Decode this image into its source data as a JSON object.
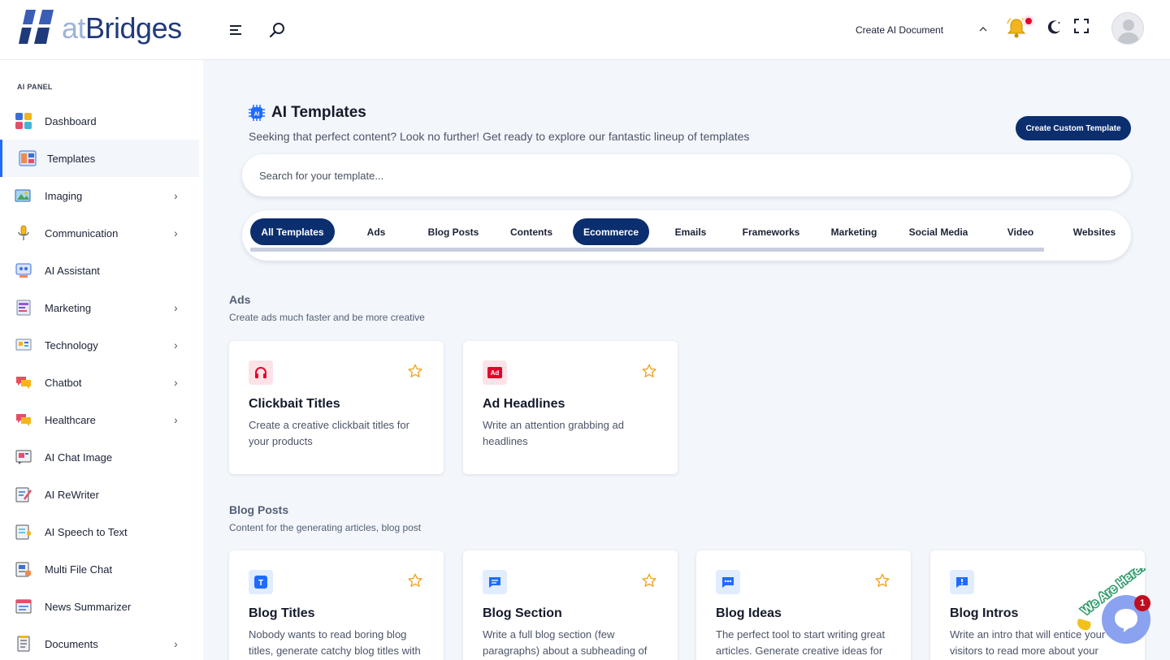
{
  "brand": {
    "logo_a": "at",
    "logo_b": "Bridges"
  },
  "header": {
    "create_doc": "Create AI Document"
  },
  "sidebar": {
    "panel_label": "AI PANEL",
    "items": [
      {
        "label": "Dashboard",
        "icon": "dashboard-icon",
        "chevron": false
      },
      {
        "label": "Templates",
        "icon": "templates-icon",
        "chevron": false,
        "active": true
      },
      {
        "label": "Imaging",
        "icon": "imaging-icon",
        "chevron": true
      },
      {
        "label": "Communication",
        "icon": "microphone-icon",
        "chevron": true
      },
      {
        "label": "AI Assistant",
        "icon": "assistant-icon",
        "chevron": false
      },
      {
        "label": "Marketing",
        "icon": "marketing-icon",
        "chevron": true
      },
      {
        "label": "Technology",
        "icon": "technology-icon",
        "chevron": true
      },
      {
        "label": "Chatbot",
        "icon": "chatbot-icon",
        "chevron": true
      },
      {
        "label": "Healthcare",
        "icon": "healthcare-icon",
        "chevron": true
      },
      {
        "label": "AI Chat Image",
        "icon": "chat-image-icon",
        "chevron": false
      },
      {
        "label": "AI ReWriter",
        "icon": "rewriter-icon",
        "chevron": false
      },
      {
        "label": "AI Speech to Text",
        "icon": "speech-icon",
        "chevron": false
      },
      {
        "label": "Multi File Chat",
        "icon": "file-chat-icon",
        "chevron": false
      },
      {
        "label": "News Summarizer",
        "icon": "news-icon",
        "chevron": false
      },
      {
        "label": "Documents",
        "icon": "documents-icon",
        "chevron": true
      }
    ]
  },
  "main": {
    "title": "AI Templates",
    "subtitle": "Seeking that perfect content? Look no further! Get ready to explore our fantastic lineup of templates",
    "custom_button": "Create Custom Template",
    "search_placeholder": "Search for your template...",
    "tabs": [
      {
        "label": "All Templates",
        "active": true
      },
      {
        "label": "Ads",
        "active": false
      },
      {
        "label": "Blog Posts",
        "active": false
      },
      {
        "label": "Contents",
        "active": false
      },
      {
        "label": "Ecommerce",
        "active": true
      },
      {
        "label": "Emails",
        "active": false
      },
      {
        "label": "Frameworks",
        "active": false
      },
      {
        "label": "Marketing",
        "active": false
      },
      {
        "label": "Social Media",
        "active": false
      },
      {
        "label": "Video",
        "active": false
      },
      {
        "label": "Websites",
        "active": false
      }
    ],
    "sections": [
      {
        "title": "Ads",
        "subtitle": "Create ads much faster and be more creative",
        "cards": [
          {
            "title": "Clickbait Titles",
            "desc": "Create a creative clickbait titles for your products",
            "icon": "headphones-icon"
          },
          {
            "title": "Ad Headlines",
            "desc": "Write an attention grabbing ad headlines",
            "icon": "ad-icon"
          }
        ]
      },
      {
        "title": "Blog Posts",
        "subtitle": "Content for the generating articles, blog post",
        "cards": [
          {
            "title": "Blog Titles",
            "desc": "Nobody wants to read boring blog titles, generate catchy blog titles with",
            "icon": "text-icon"
          },
          {
            "title": "Blog Section",
            "desc": "Write a full blog section (few paragraphs) about a subheading of",
            "icon": "message-icon"
          },
          {
            "title": "Blog Ideas",
            "desc": "The perfect tool to start writing great articles. Generate creative ideas for",
            "icon": "dots-icon"
          },
          {
            "title": "Blog Intros",
            "desc": "Write an intro that will entice your visitors to read more about your",
            "icon": "exclamation-icon"
          }
        ]
      }
    ]
  },
  "chat": {
    "badge": "1",
    "tagline": "We Are Here!"
  },
  "colors": {
    "primary": "#0b2e6e",
    "accent": "#1f6bff",
    "star": "#f0a21b",
    "red_icon": "#e4002b",
    "blue_icon": "#1f6bff"
  }
}
